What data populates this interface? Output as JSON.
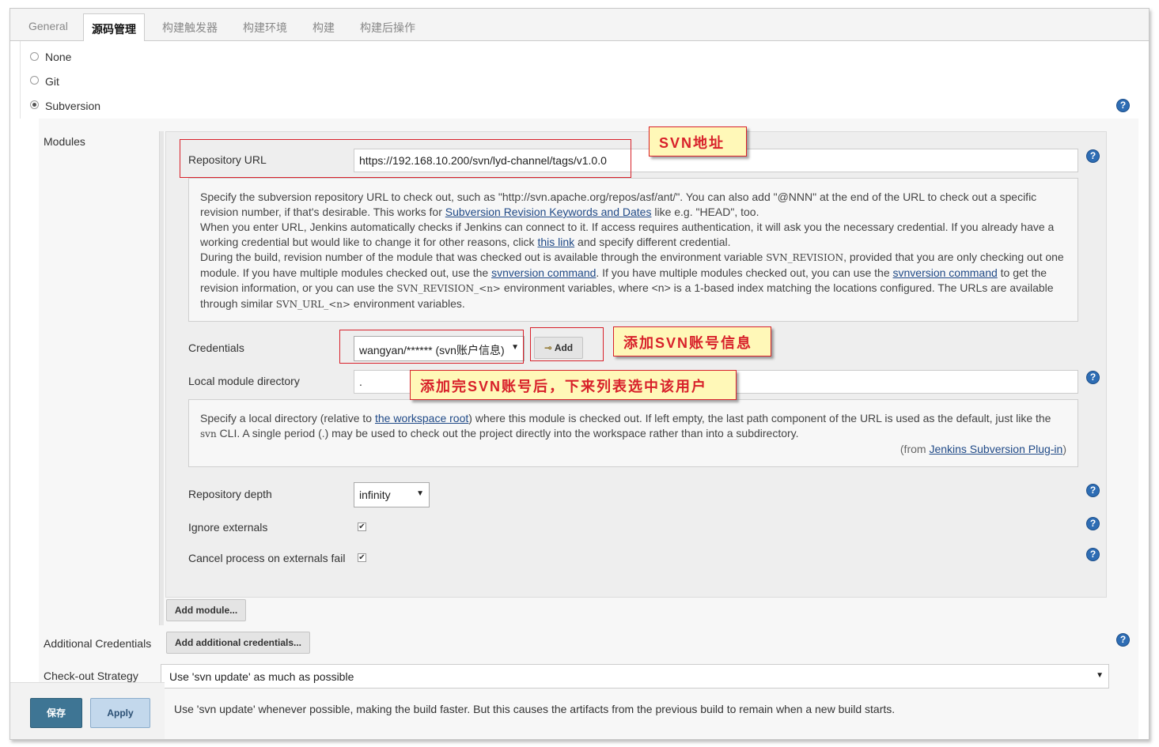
{
  "tabs": [
    "General",
    "源码管理",
    "构建触发器",
    "构建环境",
    "构建",
    "构建后操作"
  ],
  "scm": {
    "options": [
      "None",
      "Git",
      "Subversion"
    ],
    "selected": "Subversion"
  },
  "modules": {
    "label": "Modules",
    "repository_url_label": "Repository URL",
    "repository_url_value": "https://192.168.10.200/svn/lyd-channel/tags/v1.0.0",
    "repo_help": {
      "p1_a": "Specify the subversion repository URL to check out, such as \"http://svn.apache.org/repos/asf/ant/\". You can also add \"@NNN\" at the end of the URL to check out a specific revision number, if that's desirable. This works for ",
      "p1_link": "Subversion Revision Keywords and Dates",
      "p1_b": " like e.g. \"HEAD\", too.",
      "p2_a": "When you enter URL, Jenkins automatically checks if Jenkins can connect to it. If access requires authentication, it will ask you the necessary credential. If you already have a working credential but would like to change it for other reasons, click ",
      "p2_link": "this link",
      "p2_b": " and specify different credential.",
      "p3_a": "During the build, revision number of the module that was checked out is available through the environment variable ",
      "p3_code1": "SVN_REVISION",
      "p3_b": ", provided that you are only checking out one module. If you have multiple modules checked out, use the ",
      "p3_link1": "svnversion command",
      "p3_c": ". If you have multiple modules checked out, you can use the ",
      "p3_link2": "svnversion command",
      "p3_d": " to get the revision information, or you can use the ",
      "p3_code2": "SVN_REVISION_<n>",
      "p3_e": " environment variables, where <n> is a 1-based index matching the locations configured. The URLs are available through similar ",
      "p3_code3": "SVN_URL_<n>",
      "p3_f": " environment variables."
    },
    "credentials_label": "Credentials",
    "credentials_value": "wangyan/****** (svn账户信息)",
    "add_button": "Add",
    "local_dir_label": "Local module directory",
    "local_dir_value": ".",
    "local_help": {
      "a": "Specify a local directory (relative to ",
      "link1": "the workspace root",
      "b": ") where this module is checked out. If left empty, the last path component of the URL is used as the default, just like the ",
      "code": "svn",
      "c": " CLI. A single period (",
      "code2": ".",
      "d": ") may be used to check out the project directly into the workspace rather than into a subdirectory.",
      "from_a": "(from ",
      "from_link": "Jenkins Subversion Plug-in",
      "from_b": ")"
    },
    "depth_label": "Repository depth",
    "depth_value": "infinity",
    "ignore_externals_label": "Ignore externals",
    "ignore_externals_checked": true,
    "cancel_externals_label": "Cancel process on externals fail",
    "cancel_externals_checked": true,
    "add_module_button": "Add module..."
  },
  "additional_credentials": {
    "label": "Additional Credentials",
    "button": "Add additional credentials..."
  },
  "checkout_strategy": {
    "label": "Check-out Strategy",
    "value": "Use 'svn update' as much as possible",
    "description": "Use 'svn update' whenever possible, making the build faster. But this causes the artifacts from the previous build to remain when a new build starts."
  },
  "buttons": {
    "save": "保存",
    "apply": "Apply"
  },
  "annotations": {
    "svn_address": "SVN地址",
    "add_account": "添加SVN账号信息",
    "after_add": "添加完SVN账号后，下来列表选中该用户"
  },
  "colors": {
    "annotation_red": "#d8202a",
    "annotation_bg": "#fff8b8",
    "save_button": "#3e7594",
    "apply_button": "#c3d8ec",
    "help_icon": "#2e6db4"
  }
}
